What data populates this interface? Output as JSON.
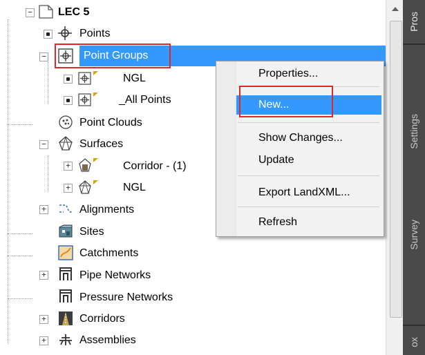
{
  "tree": {
    "root": "LEC 5",
    "points": "Points",
    "point_groups": "Point Groups",
    "pg_ngl": "NGL",
    "pg_all": "_All Points",
    "point_clouds": "Point Clouds",
    "surfaces": "Surfaces",
    "surf_corridor": "Corridor - (1)",
    "surf_ngl": "NGL",
    "alignments": "Alignments",
    "sites": "Sites",
    "catchments": "Catchments",
    "pipe_networks": "Pipe Networks",
    "pressure_networks": "Pressure Networks",
    "corridors": "Corridors",
    "assemblies": "Assemblies"
  },
  "context_menu": {
    "properties": "Properties...",
    "new": "New...",
    "show_changes": "Show Changes...",
    "update": "Update",
    "export": "Export LandXML...",
    "refresh": "Refresh"
  },
  "side_tabs": {
    "prospector": "Pros",
    "settings": "Settings",
    "survey": "Survey",
    "toolbox": "ox"
  },
  "colors": {
    "selection": "#3399ff",
    "highlight_box": "#e0282b",
    "side_tabs": "#4a4a4a"
  }
}
